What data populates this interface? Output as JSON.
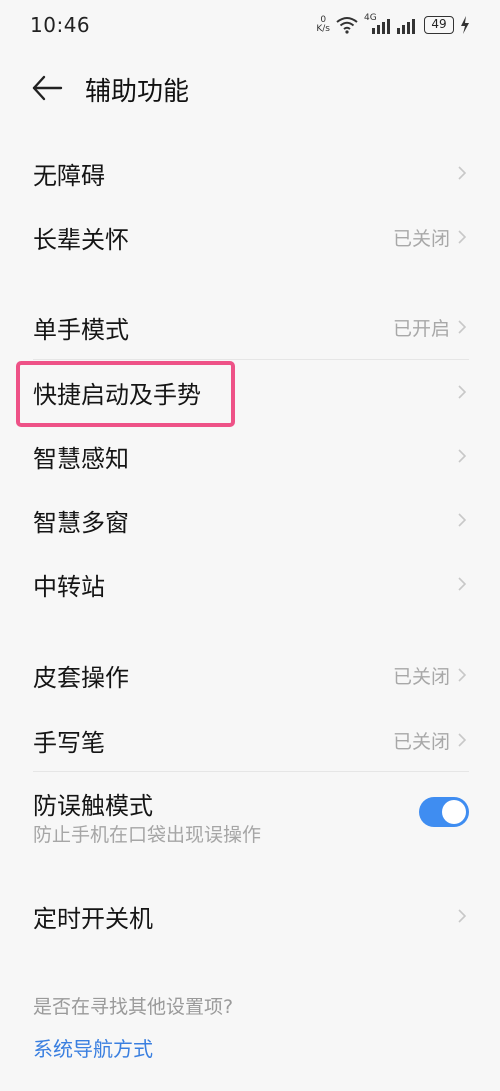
{
  "status_bar": {
    "time": "10:46",
    "net_speed_value": "0",
    "net_speed_unit": "K/s",
    "signal_label": "4G",
    "battery": "49",
    "icons": [
      "wifi-icon",
      "signal-icon",
      "signal-icon",
      "battery-icon",
      "charging-icon"
    ]
  },
  "header": {
    "title": "辅助功能",
    "back_icon": "back-arrow-icon"
  },
  "items": [
    {
      "label": "无障碍",
      "status": ""
    },
    {
      "label": "长辈关怀",
      "status": "已关闭"
    },
    {
      "label": "单手模式",
      "status": "已开启"
    },
    {
      "label": "快捷启动及手势",
      "status": ""
    },
    {
      "label": "智慧感知",
      "status": ""
    },
    {
      "label": "智慧多窗",
      "status": ""
    },
    {
      "label": "中转站",
      "status": ""
    },
    {
      "label": "皮套操作",
      "status": "已关闭"
    },
    {
      "label": "手写笔",
      "status": "已关闭"
    },
    {
      "label": "防误触模式",
      "subtitle": "防止手机在口袋出现误操作",
      "toggle_on": true
    },
    {
      "label": "定时开关机",
      "status": ""
    }
  ],
  "footer": {
    "question": "是否在寻找其他设置项?",
    "link": "系统导航方式"
  },
  "colors": {
    "accent": "#3f8df1",
    "link": "#3a7fe0",
    "highlight": "#ee5287",
    "background": "#f7f7f7"
  }
}
